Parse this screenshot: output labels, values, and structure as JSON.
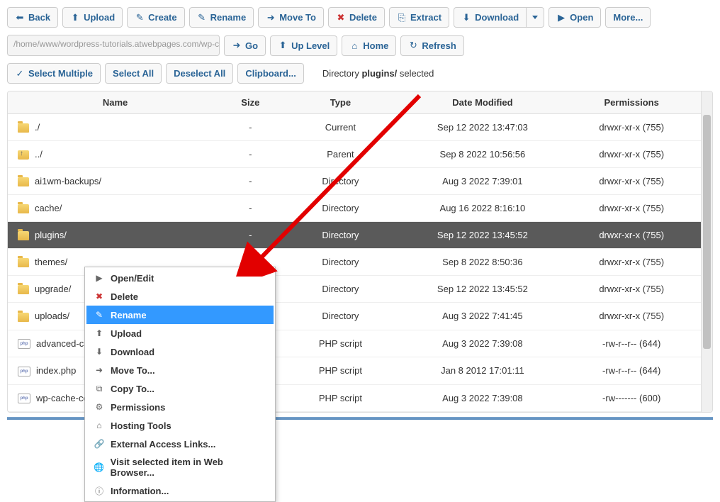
{
  "toolbar": {
    "back": "Back",
    "upload": "Upload",
    "create": "Create",
    "rename": "Rename",
    "moveto": "Move To",
    "delete": "Delete",
    "extract": "Extract",
    "download": "Download",
    "open": "Open",
    "more": "More..."
  },
  "pathbar": {
    "path": "/home/www/wordpress-tutorials.atwebpages.com/wp-con",
    "go": "Go",
    "uplevel": "Up Level",
    "home": "Home",
    "refresh": "Refresh"
  },
  "selbar": {
    "selectmultiple": "Select Multiple",
    "selectall": "Select All",
    "deselectall": "Deselect All",
    "clipboard": "Clipboard...",
    "status_prefix": "Directory ",
    "status_bold": "plugins/",
    "status_suffix": " selected"
  },
  "columns": {
    "name": "Name",
    "size": "Size",
    "type": "Type",
    "modified": "Date Modified",
    "permissions": "Permissions"
  },
  "rows": [
    {
      "icon": "folder",
      "name": "./",
      "size": "-",
      "type": "Current",
      "modified": "Sep 12 2022 13:47:03",
      "perm": "drwxr-xr-x (755)",
      "selected": false
    },
    {
      "icon": "folder-up",
      "name": "../",
      "size": "-",
      "type": "Parent",
      "modified": "Sep 8 2022 10:56:56",
      "perm": "drwxr-xr-x (755)",
      "selected": false
    },
    {
      "icon": "folder",
      "name": "ai1wm-backups/",
      "size": "-",
      "type": "Directory",
      "modified": "Aug 3 2022 7:39:01",
      "perm": "drwxr-xr-x (755)",
      "selected": false
    },
    {
      "icon": "folder",
      "name": "cache/",
      "size": "-",
      "type": "Directory",
      "modified": "Aug 16 2022 8:16:10",
      "perm": "drwxr-xr-x (755)",
      "selected": false
    },
    {
      "icon": "folder",
      "name": "plugins/",
      "size": "-",
      "type": "Directory",
      "modified": "Sep 12 2022 13:45:52",
      "perm": "drwxr-xr-x (755)",
      "selected": true
    },
    {
      "icon": "folder",
      "name": "themes/",
      "size": "",
      "type": "Directory",
      "modified": "Sep 8 2022 8:50:36",
      "perm": "drwxr-xr-x (755)",
      "selected": false
    },
    {
      "icon": "folder",
      "name": "upgrade/",
      "size": "",
      "type": "Directory",
      "modified": "Sep 12 2022 13:45:52",
      "perm": "drwxr-xr-x (755)",
      "selected": false
    },
    {
      "icon": "folder",
      "name": "uploads/",
      "size": "",
      "type": "Directory",
      "modified": "Aug 3 2022 7:41:45",
      "perm": "drwxr-xr-x (755)",
      "selected": false
    },
    {
      "icon": "php",
      "name": "advanced-ca",
      "size": "",
      "type": "PHP script",
      "modified": "Aug 3 2022 7:39:08",
      "perm": "-rw-r--r-- (644)",
      "selected": false
    },
    {
      "icon": "php",
      "name": "index.php",
      "size": "",
      "type": "PHP script",
      "modified": "Jan 8 2012 17:01:11",
      "perm": "-rw-r--r-- (644)",
      "selected": false
    },
    {
      "icon": "php",
      "name": "wp-cache-co",
      "size": "",
      "type": "PHP script",
      "modified": "Aug 3 2022 7:39:08",
      "perm": "-rw------- (600)",
      "selected": false
    }
  ],
  "contextmenu": [
    {
      "icon": "▶",
      "label": "Open/Edit",
      "hl": false
    },
    {
      "icon": "✖",
      "label": "Delete",
      "hl": false,
      "color": "#c33"
    },
    {
      "icon": "✎",
      "label": "Rename",
      "hl": true
    },
    {
      "icon": "⬆",
      "label": "Upload",
      "hl": false
    },
    {
      "icon": "⬇",
      "label": "Download",
      "hl": false
    },
    {
      "icon": "➜",
      "label": "Move To...",
      "hl": false
    },
    {
      "icon": "⧉",
      "label": "Copy To...",
      "hl": false
    },
    {
      "icon": "⚙",
      "label": "Permissions",
      "hl": false
    },
    {
      "icon": "⌂",
      "label": "Hosting Tools",
      "hl": false
    },
    {
      "icon": "🔗",
      "label": "External Access Links...",
      "hl": false
    },
    {
      "icon": "🌐",
      "label": "Visit selected item in Web Browser...",
      "hl": false
    },
    {
      "icon": "ⓘ",
      "label": "Information...",
      "hl": false
    }
  ],
  "icons": {
    "back": "⬅",
    "upload": "⬆",
    "create": "✎",
    "rename": "✎",
    "moveto": "➜",
    "delete": "✖",
    "extract": "⎘",
    "download": "⬇",
    "open": "▶",
    "go": "➜",
    "uplevel": "⬆",
    "home": "⌂",
    "refresh": "↻",
    "check": "✓"
  }
}
